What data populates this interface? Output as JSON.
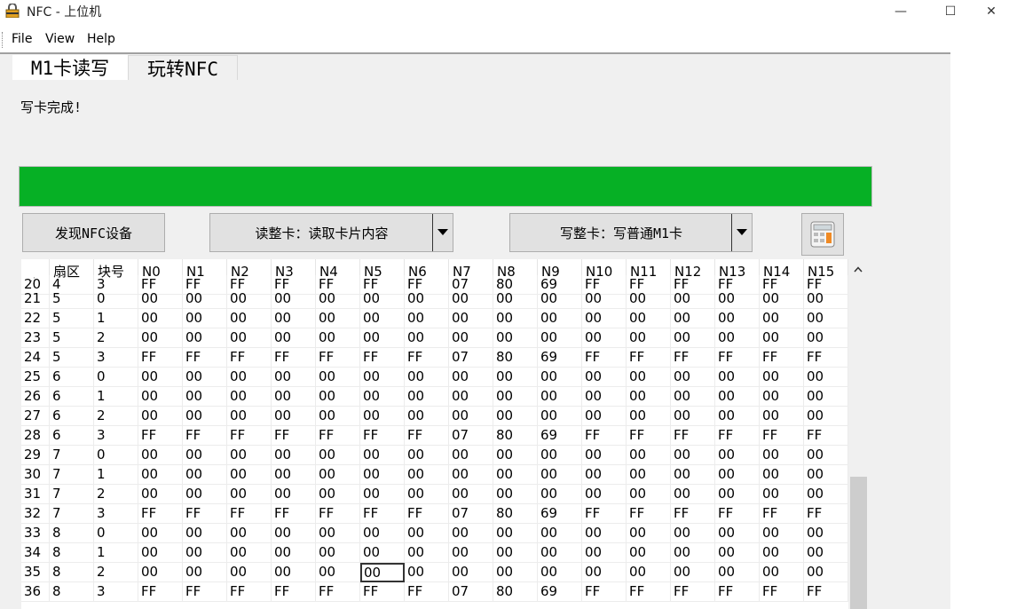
{
  "window": {
    "title": "NFC - 上位机",
    "minimize_glyph": "—",
    "maximize_glyph": "☐",
    "close_glyph": "✕"
  },
  "menu": [
    "File",
    "View",
    "Help"
  ],
  "tabs": [
    {
      "label": "M1卡读写",
      "active": true
    },
    {
      "label": "玩转NFC",
      "active": false
    }
  ],
  "status_text": "写卡完成!",
  "progress": {
    "percent": 100,
    "color": "#06b025"
  },
  "buttons": {
    "discover": "发现NFC设备",
    "read_select": "读整卡：读取卡片内容",
    "write_select": "写整卡：写普通M1卡"
  },
  "icons": {
    "calculator": "calculator-icon",
    "dropdown": "chevron-down-icon",
    "scroll_up": "chevron-up-icon",
    "app": "lock-icon"
  },
  "table": {
    "columns": [
      "",
      "扇区",
      "块号",
      "N0",
      "N1",
      "N2",
      "N3",
      "N4",
      "N5",
      "N6",
      "N7",
      "N8",
      "N9",
      "N10",
      "N11",
      "N12",
      "N13",
      "N14",
      "N15"
    ],
    "partial_row": [
      "20",
      "4",
      "3",
      "FF",
      "FF",
      "FF",
      "FF",
      "FF",
      "FF",
      "FF",
      "07",
      "80",
      "69",
      "FF",
      "FF",
      "FF",
      "FF",
      "FF",
      "FF"
    ],
    "rows": [
      [
        "21",
        "5",
        "0",
        "00",
        "00",
        "00",
        "00",
        "00",
        "00",
        "00",
        "00",
        "00",
        "00",
        "00",
        "00",
        "00",
        "00",
        "00",
        "00"
      ],
      [
        "22",
        "5",
        "1",
        "00",
        "00",
        "00",
        "00",
        "00",
        "00",
        "00",
        "00",
        "00",
        "00",
        "00",
        "00",
        "00",
        "00",
        "00",
        "00"
      ],
      [
        "23",
        "5",
        "2",
        "00",
        "00",
        "00",
        "00",
        "00",
        "00",
        "00",
        "00",
        "00",
        "00",
        "00",
        "00",
        "00",
        "00",
        "00",
        "00"
      ],
      [
        "24",
        "5",
        "3",
        "FF",
        "FF",
        "FF",
        "FF",
        "FF",
        "FF",
        "FF",
        "07",
        "80",
        "69",
        "FF",
        "FF",
        "FF",
        "FF",
        "FF",
        "FF"
      ],
      [
        "25",
        "6",
        "0",
        "00",
        "00",
        "00",
        "00",
        "00",
        "00",
        "00",
        "00",
        "00",
        "00",
        "00",
        "00",
        "00",
        "00",
        "00",
        "00"
      ],
      [
        "26",
        "6",
        "1",
        "00",
        "00",
        "00",
        "00",
        "00",
        "00",
        "00",
        "00",
        "00",
        "00",
        "00",
        "00",
        "00",
        "00",
        "00",
        "00"
      ],
      [
        "27",
        "6",
        "2",
        "00",
        "00",
        "00",
        "00",
        "00",
        "00",
        "00",
        "00",
        "00",
        "00",
        "00",
        "00",
        "00",
        "00",
        "00",
        "00"
      ],
      [
        "28",
        "6",
        "3",
        "FF",
        "FF",
        "FF",
        "FF",
        "FF",
        "FF",
        "FF",
        "07",
        "80",
        "69",
        "FF",
        "FF",
        "FF",
        "FF",
        "FF",
        "FF"
      ],
      [
        "29",
        "7",
        "0",
        "00",
        "00",
        "00",
        "00",
        "00",
        "00",
        "00",
        "00",
        "00",
        "00",
        "00",
        "00",
        "00",
        "00",
        "00",
        "00"
      ],
      [
        "30",
        "7",
        "1",
        "00",
        "00",
        "00",
        "00",
        "00",
        "00",
        "00",
        "00",
        "00",
        "00",
        "00",
        "00",
        "00",
        "00",
        "00",
        "00"
      ],
      [
        "31",
        "7",
        "2",
        "00",
        "00",
        "00",
        "00",
        "00",
        "00",
        "00",
        "00",
        "00",
        "00",
        "00",
        "00",
        "00",
        "00",
        "00",
        "00"
      ],
      [
        "32",
        "7",
        "3",
        "FF",
        "FF",
        "FF",
        "FF",
        "FF",
        "FF",
        "FF",
        "07",
        "80",
        "69",
        "FF",
        "FF",
        "FF",
        "FF",
        "FF",
        "FF"
      ],
      [
        "33",
        "8",
        "0",
        "00",
        "00",
        "00",
        "00",
        "00",
        "00",
        "00",
        "00",
        "00",
        "00",
        "00",
        "00",
        "00",
        "00",
        "00",
        "00"
      ],
      [
        "34",
        "8",
        "1",
        "00",
        "00",
        "00",
        "00",
        "00",
        "00",
        "00",
        "00",
        "00",
        "00",
        "00",
        "00",
        "00",
        "00",
        "00",
        "00"
      ],
      [
        "35",
        "8",
        "2",
        "00",
        "00",
        "00",
        "00",
        "00",
        "00",
        "00",
        "00",
        "00",
        "00",
        "00",
        "00",
        "00",
        "00",
        "00",
        "00"
      ],
      [
        "36",
        "8",
        "3",
        "FF",
        "FF",
        "FF",
        "FF",
        "FF",
        "FF",
        "FF",
        "07",
        "80",
        "69",
        "FF",
        "FF",
        "FF",
        "FF",
        "FF",
        "FF"
      ]
    ],
    "selected_cell": {
      "row": 14,
      "col": 8
    }
  }
}
